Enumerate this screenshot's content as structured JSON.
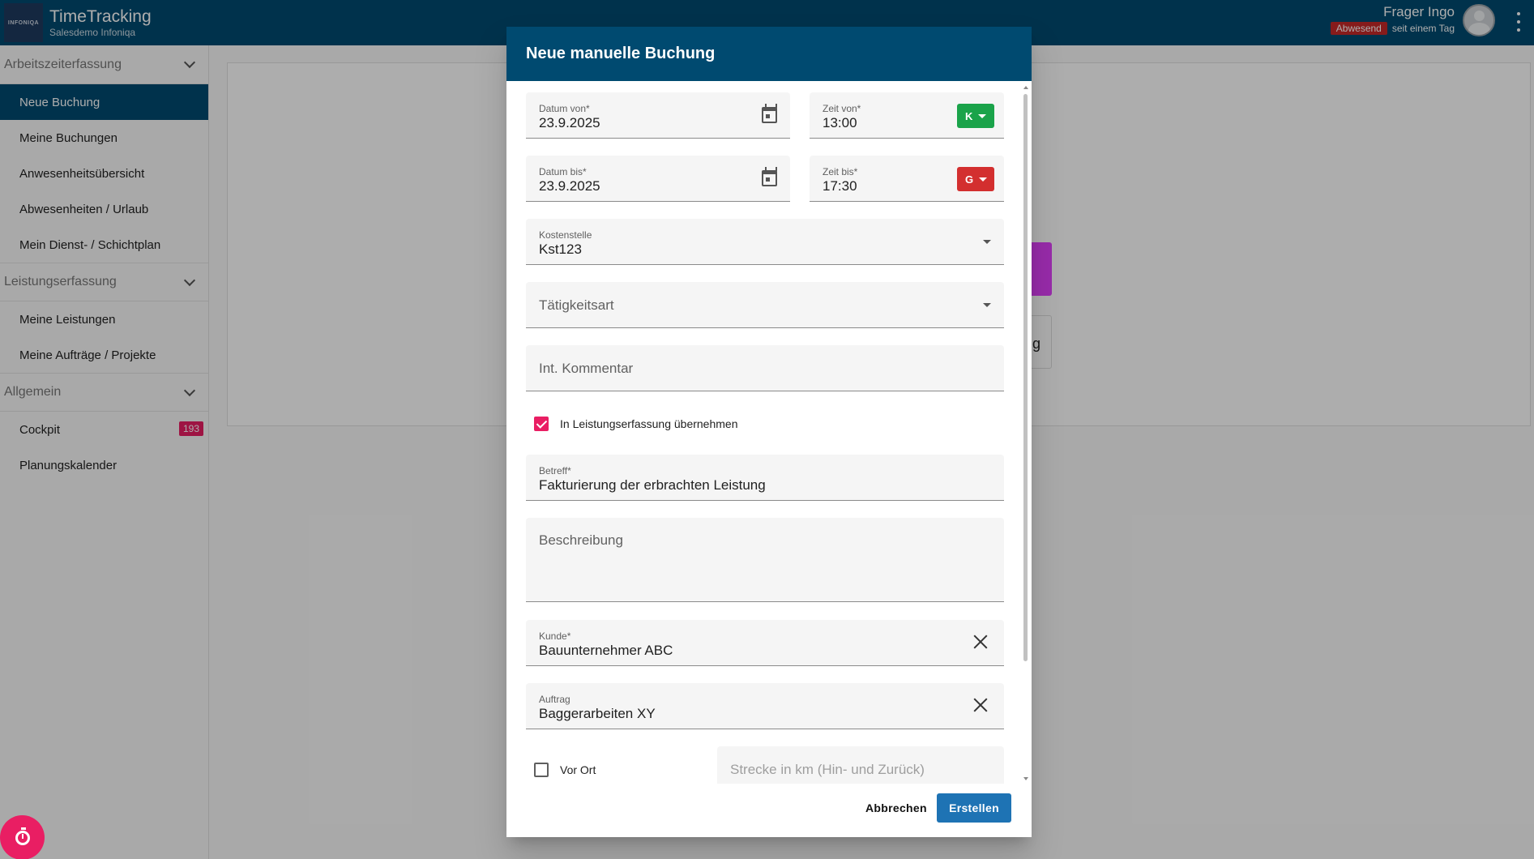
{
  "header": {
    "logo_text": "INFONIQA",
    "app_title": "TimeTracking",
    "app_subtitle": "Salesdemo Infoniqa",
    "user_name": "Frager Ingo",
    "status_badge": "Abwesend",
    "status_since": "seit einem Tag"
  },
  "sidebar": {
    "sections": [
      {
        "title": "Arbeitszeiterfassung",
        "items": [
          {
            "label": "Neue Buchung",
            "active": true
          },
          {
            "label": "Meine Buchungen"
          },
          {
            "label": "Anwesenheitsübersicht"
          },
          {
            "label": "Abwesenheiten / Urlaub"
          },
          {
            "label": "Mein Dienst- / Schichtplan"
          }
        ]
      },
      {
        "title": "Leistungserfassung",
        "items": [
          {
            "label": "Meine Leistungen"
          },
          {
            "label": "Meine Aufträge / Projekte"
          }
        ]
      },
      {
        "title": "Allgemein",
        "items": [
          {
            "label": "Cockpit",
            "badge": "193"
          },
          {
            "label": "Planungskalender"
          }
        ]
      }
    ]
  },
  "background": {
    "partial_button_text": "g"
  },
  "dialog": {
    "title": "Neue manuelle Buchung",
    "datum_von": {
      "label": "Datum von*",
      "value": "23.9.2025"
    },
    "zeit_von": {
      "label": "Zeit von*",
      "value": "13:00",
      "type_button": "K",
      "type_color": "#1aa34a"
    },
    "datum_bis": {
      "label": "Datum bis*",
      "value": "23.9.2025"
    },
    "zeit_bis": {
      "label": "Zeit bis*",
      "value": "17:30",
      "type_button": "G",
      "type_color": "#d32f2f"
    },
    "kostenstelle": {
      "label": "Kostenstelle",
      "value": "Kst123"
    },
    "taetigkeitsart": {
      "placeholder": "Tätigkeitsart"
    },
    "int_kommentar": {
      "placeholder": "Int. Kommentar"
    },
    "leistungserfassung_checkbox": {
      "label": "In Leistungserfassung übernehmen",
      "checked": true
    },
    "betreff": {
      "label": "Betreff*",
      "value": "Fakturierung der erbrachten Leistung"
    },
    "beschreibung": {
      "placeholder": "Beschreibung"
    },
    "kunde": {
      "label": "Kunde*",
      "value": "Bauunternehmer ABC"
    },
    "auftrag": {
      "label": "Auftrag",
      "value": "Baggerarbeiten XY"
    },
    "vor_ort_checkbox": {
      "label": "Vor Ort",
      "checked": false
    },
    "strecke": {
      "placeholder": "Strecke in km (Hin- und Zurück)"
    },
    "cancel_label": "Abbrechen",
    "create_label": "Erstellen"
  },
  "colors": {
    "primary": "#004a70",
    "accent": "#e91e63",
    "create_button": "#1e73b4"
  }
}
